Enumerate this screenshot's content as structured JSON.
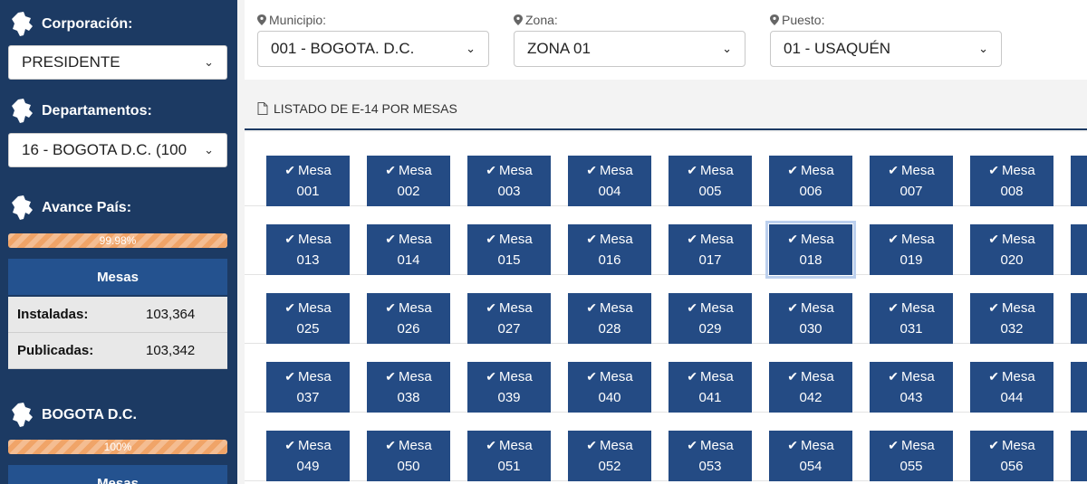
{
  "sidebar": {
    "corporacion_label": "Corporación:",
    "corporacion_value": "PRESIDENTE",
    "departamentos_label": "Departamentos:",
    "departamentos_value": "16 - BOGOTA D.C. (100",
    "avance_label": "Avance País:",
    "avance_percent": "99.98%",
    "mesas_label": "Mesas",
    "instaladas_label": "Instaladas:",
    "instaladas_value": "103,364",
    "publicadas_label": "Publicadas:",
    "publicadas_value": "103,342",
    "region_label": "BOGOTA D.C.",
    "region_percent": "100%",
    "region_mesas_label": "Mesas"
  },
  "filters": {
    "municipio_label": "Municipio:",
    "municipio_value": "001 - BOGOTA. D.C.",
    "zona_label": "Zona:",
    "zona_value": "ZONA 01",
    "puesto_label": "Puesto:",
    "puesto_value": "01 - USAQUÉN"
  },
  "listing": {
    "title": "LISTADO DE E-14 POR MESAS",
    "mesa_label": "Mesa",
    "selected": "018",
    "rows": [
      [
        "001",
        "002",
        "003",
        "004",
        "005",
        "006",
        "007",
        "008"
      ],
      [
        "013",
        "014",
        "015",
        "016",
        "017",
        "018",
        "019",
        "020"
      ],
      [
        "025",
        "026",
        "027",
        "028",
        "029",
        "030",
        "031",
        "032"
      ],
      [
        "037",
        "038",
        "039",
        "040",
        "041",
        "042",
        "043",
        "044"
      ],
      [
        "049",
        "050",
        "051",
        "052",
        "053",
        "054",
        "055",
        "056"
      ]
    ]
  },
  "colors": {
    "sidebar_bg": "#1c3a63",
    "mesa_button": "#244b84",
    "progress": "#f0a468"
  },
  "icons": {
    "map": "colombia-map-icon",
    "pin": "map-pin-icon",
    "doc": "document-icon",
    "check": "check-icon",
    "chevron": "chevron-down-icon"
  }
}
